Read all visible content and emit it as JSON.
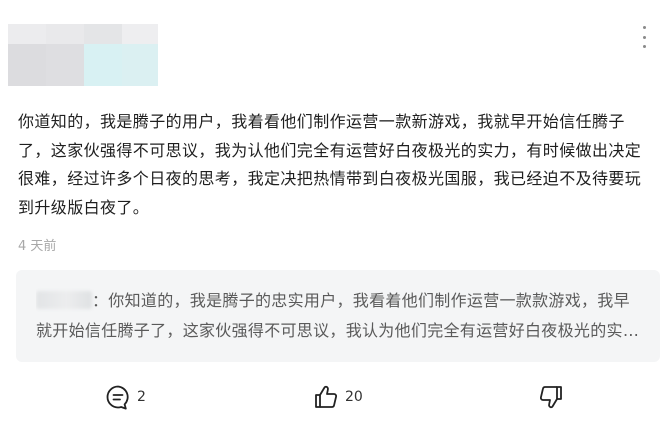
{
  "comment": {
    "text": "你道知的，我是腾子的用户，我着看他们制作运营一款新游戏，我就早开始信任腾子了，这家伙强得不可思议，我为认他们完全有运营好白夜极光的实力，有时候做出决定很难，经过许多个日夜的思考，我定决把热情带到白夜极光国服，我已经迫不及待要玩到升级版白夜了。",
    "time": "4 天前"
  },
  "quote": {
    "text": "：你知道的，我是腾子的忠实用户，我看着他们制作运营一款款游戏，我早就开始信任腾子了，这家伙强得不可思议，我认为他们完全有运营好白夜极光的实力，有时候做出决定很难，经过许多个日夜的思考，我决定把热情带到白夜极光国服，我已经迫不及待要玩到升级版白夜了。"
  },
  "actions": {
    "reply_count": "2",
    "like_count": "20",
    "reply_icon": "comment-bubble-icon",
    "like_icon": "thumbs-up-icon",
    "dislike_icon": "thumbs-down-icon"
  },
  "colors": {
    "accent_text": "#1f1f1f",
    "muted_text": "#a8a8a8",
    "quote_bg": "#f4f5f6"
  }
}
